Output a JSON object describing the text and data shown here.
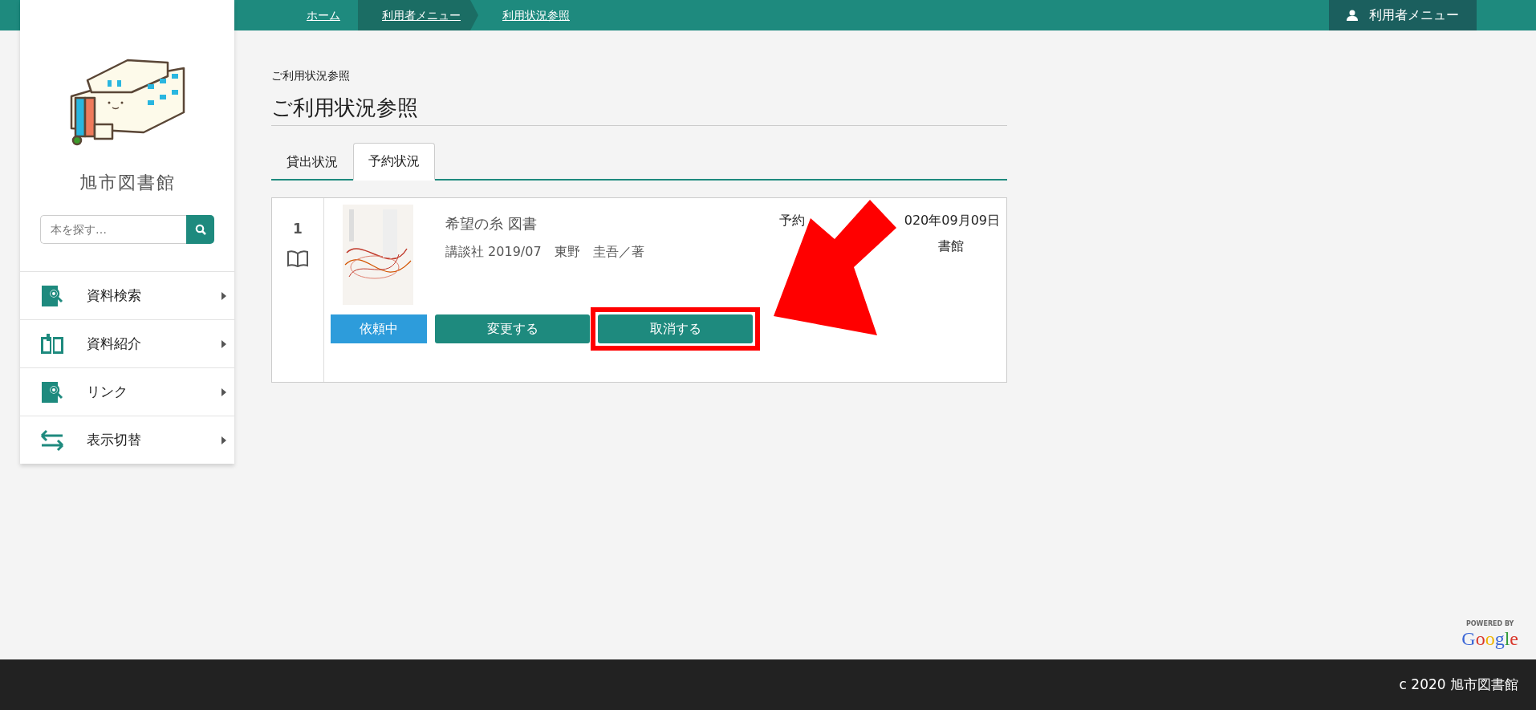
{
  "topbar": {
    "breadcrumbs": [
      {
        "label": "ホーム",
        "highlighted": false
      },
      {
        "label": "利用者メニュー",
        "highlighted": true
      },
      {
        "label": "利用状況参照",
        "highlighted": false
      }
    ],
    "user_menu": {
      "label": "利用者メニュー"
    }
  },
  "sidebar": {
    "library_name": "旭市図書館",
    "search": {
      "placeholder": "本を探す…"
    },
    "menu": [
      {
        "label": "資料検索",
        "kind": "search"
      },
      {
        "label": "資料紹介",
        "kind": "book"
      },
      {
        "label": "リンク",
        "kind": "search"
      },
      {
        "label": "表示切替",
        "kind": "switch"
      }
    ]
  },
  "page": {
    "breadcrumb": "ご利用状況参照",
    "title": "ご利用状況参照",
    "tabs": [
      {
        "label": "貸出状況",
        "selected": false
      },
      {
        "label": "予約状況",
        "selected": true
      }
    ]
  },
  "reservations": [
    {
      "number": "1",
      "title": "希望の糸 図書",
      "details": "講談社 2019/07　東野　圭吾／著",
      "status": "依頼中",
      "actions": [
        {
          "label": "変更する",
          "annotated": false
        },
        {
          "label": "取消する",
          "annotated": true
        }
      ],
      "side_texts": [
        "予約",
        "020年09月09日",
        "書館"
      ],
      "callout_arrow": true
    }
  ],
  "google_badge": {
    "caption": "POWERED BY",
    "wordmark": "Google"
  },
  "footer": {
    "copyright": "c 2020 旭市図書館"
  }
}
